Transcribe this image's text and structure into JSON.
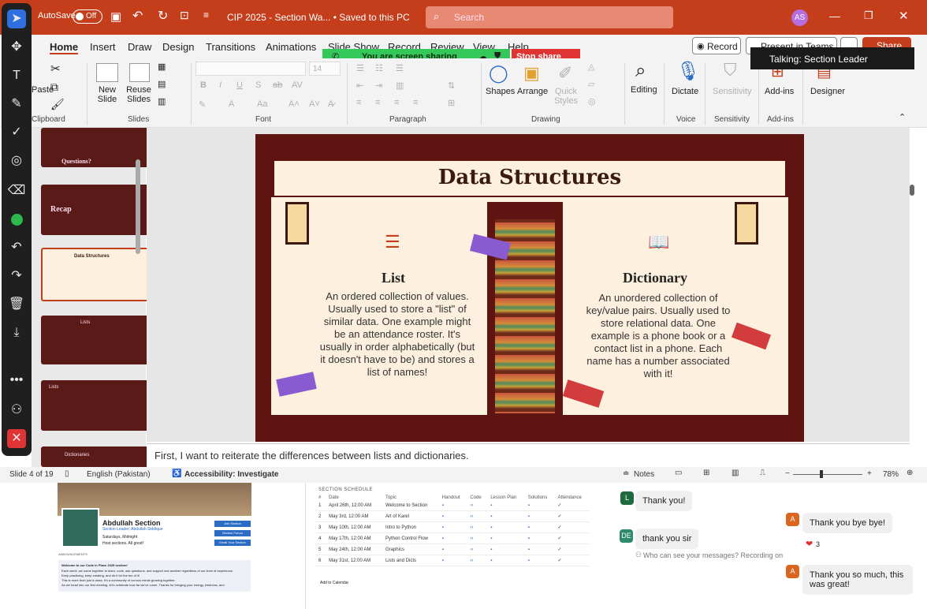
{
  "titlebar": {
    "autosave_label": "AutoSave",
    "autosave_state": "Off",
    "doc_title": "CIP 2025 - Section Wa... • Saved to this PC",
    "search_placeholder": "Search",
    "user_initials": "AS"
  },
  "sharing": {
    "status": "You are screen sharing",
    "stop_label": "Stop share",
    "talking": "Talking: Section Leader"
  },
  "tabs": [
    "Home",
    "Insert",
    "Draw",
    "Design",
    "Transitions",
    "Animations",
    "Slide Show",
    "Record",
    "Review",
    "View",
    "Help"
  ],
  "top_buttons": {
    "record": "Record",
    "present": "Present in Teams",
    "share": "Share"
  },
  "ribbon": {
    "clipboard": "Clipboard",
    "paste": "Paste",
    "new_slide": "New Slide",
    "reuse_slides": "Reuse Slides",
    "slides": "Slides",
    "font": "Font",
    "font_size": "14",
    "paragraph": "Paragraph",
    "shapes": "Shapes",
    "arrange": "Arrange",
    "quick_styles": "Quick Styles",
    "drawing": "Drawing",
    "editing": "Editing",
    "dictate": "Dictate",
    "voice": "Voice",
    "sensitivity": "Sensitivity",
    "addins": "Add-ins",
    "designer": "Designer"
  },
  "thumbs": {
    "t1": "Questions?",
    "t2": "Recap",
    "t3": "Data Structures",
    "t4": "Lists",
    "t5": "Lists",
    "t6": "Dictionaries"
  },
  "slide": {
    "title": "Data Structures",
    "list_heading": "List",
    "list_text": "An ordered collection of values. Usually used to store a \"list\" of similar data. One example might be an attendance roster. It's usually in order alphabetically (but it doesn't have to be) and stores a list of names!",
    "dict_heading": "Dictionary",
    "dict_text": "An unordered collection of key/value pairs. Usually used to store relational data. One example is a phone book or a contact list in a phone. Each name has a number associated with it!"
  },
  "notes": "First, I want to reiterate the differences between lists and dictionaries.",
  "status": {
    "slide": "Slide 4 of 19",
    "language": "English (Pakistan)",
    "accessibility": "Accessibility: Investigate",
    "notes": "Notes",
    "zoom": "78%"
  },
  "profile": {
    "name": "Abdullah Section",
    "role": "Section Leader: Abdullah Siddique",
    "time": "Saturdays, Midnight",
    "students": "Host sections. All good!",
    "btn1": "Join Section",
    "btn2": "Section Forum",
    "btn3": "Email Your Section",
    "announcements": "ANNOUNCEMENTS",
    "ann1": "Welcome to our Code in Place 2025 section!",
    "ann2": "Each week, we come together to learn, code, ask questions, and support one another regardless of our level of experience.",
    "ann3": "Keep practicing, keep creating, and do it for the fun of it!",
    "ann4": "This is more than just a class. It's a community of curious minds growing together.",
    "ann5": "As we head into our first meeting, let's celebrate how far we've come. Thanks for bringing your energy, kindness, and"
  },
  "schedule": {
    "title": "SECTION SCHEDULE",
    "headers": [
      "#",
      "Date",
      "Topic",
      "Handout",
      "Code",
      "Lesson Plan",
      "Solutions",
      "Attendance"
    ],
    "rows": [
      [
        "1",
        "April 26th, 12:00 AM",
        "Welcome to Section"
      ],
      [
        "2",
        "May 3rd, 12:00 AM",
        "Art of Karel"
      ],
      [
        "3",
        "May 10th, 12:00 AM",
        "Intro to Python"
      ],
      [
        "4",
        "May 17th, 12:00 AM",
        "Python Control Flow"
      ],
      [
        "5",
        "May 24th, 12:00 AM",
        "Graphics"
      ],
      [
        "6",
        "May 31st, 12:00 AM",
        "Lists and Dicts"
      ]
    ],
    "add_calendar": "Add to Calendar"
  },
  "chat": {
    "m1": "Thank you!",
    "m2": "thank you sir",
    "who_can_see": "Who can see your messages? Recording on",
    "m3": "Thank you bye bye!",
    "reaction": "3",
    "m4": "Thank you so much, this was great!",
    "a1": "L",
    "a2": "DE",
    "a3": "A",
    "a4": "A"
  },
  "colors": {
    "accent": "#c43e1c",
    "slide_dark": "#5e1512",
    "slide_bg": "#fdf0df",
    "share_green": "#34c759",
    "stop_red": "#e03434"
  }
}
